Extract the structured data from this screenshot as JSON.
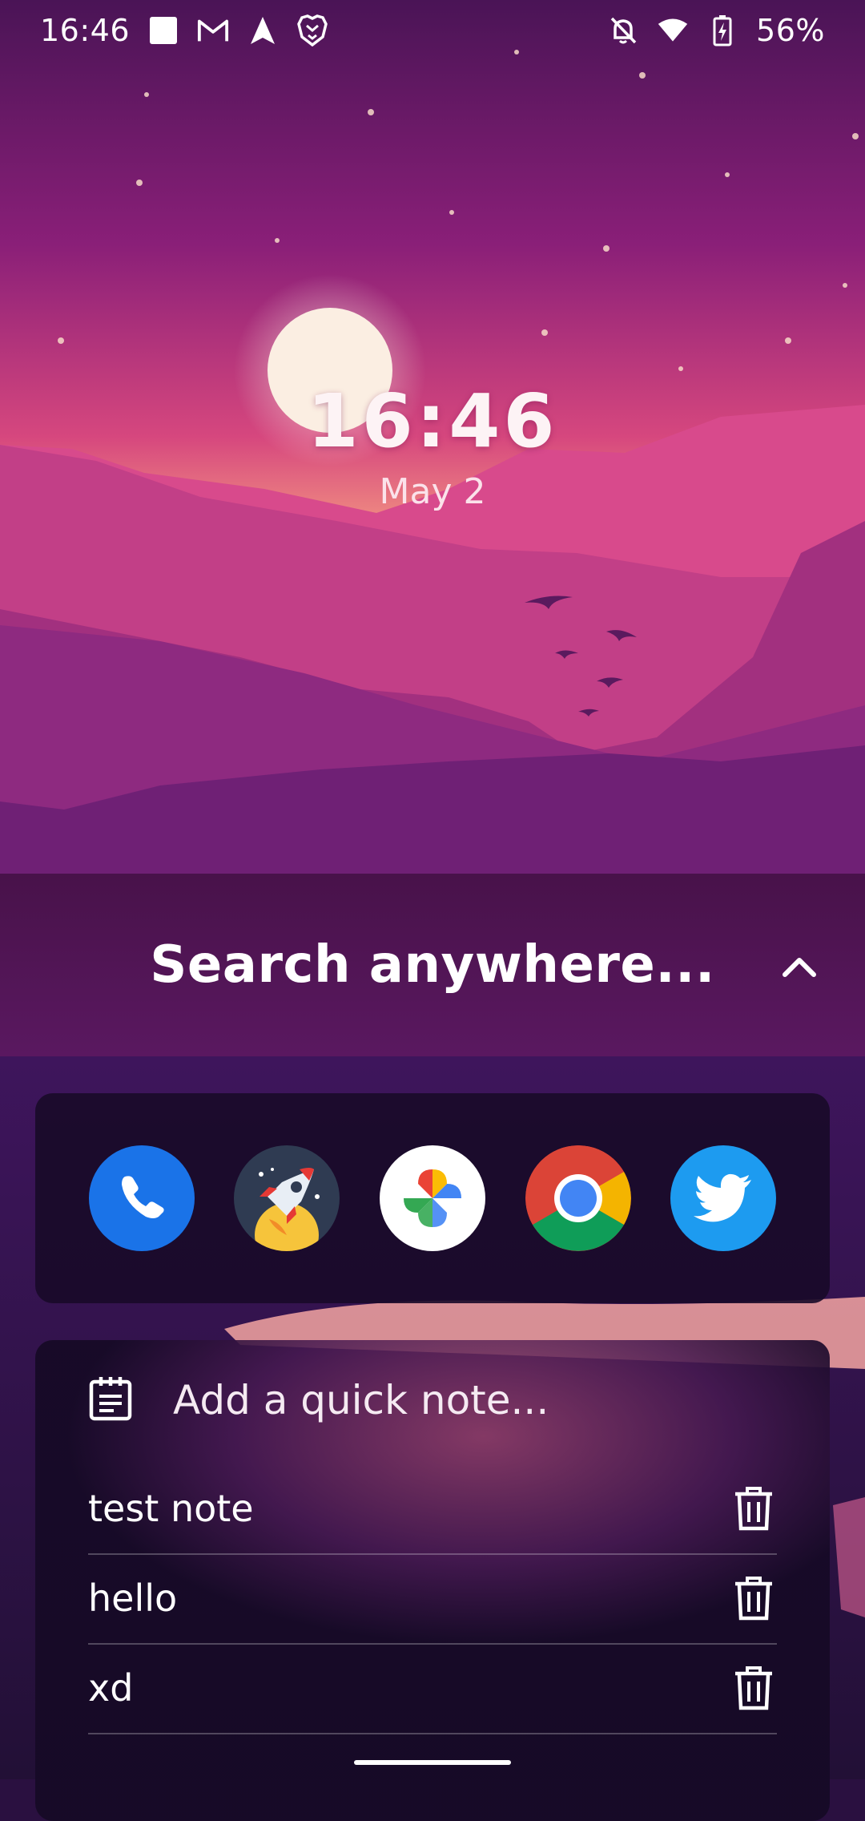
{
  "status_bar": {
    "time": "16:46",
    "battery_percent": "56%",
    "left_icons": [
      "square-notification-icon",
      "gmail-icon",
      "navigation-arrow-icon",
      "brave-lion-icon"
    ],
    "right_icons": [
      "bell-off-icon",
      "wifi-icon",
      "battery-charging-icon"
    ]
  },
  "clock": {
    "time": "16:46",
    "date": "May 2"
  },
  "search": {
    "placeholder": "Search anywhere..."
  },
  "apps": [
    {
      "name": "Phone",
      "icon": "phone-icon",
      "color": "#1a73e8"
    },
    {
      "name": "Launcher",
      "icon": "rocket-icon",
      "color": "#2f3b52"
    },
    {
      "name": "Photos",
      "icon": "pinwheel-icon",
      "color": "#ffffff"
    },
    {
      "name": "Chrome",
      "icon": "chrome-icon",
      "color": "#4285f4"
    },
    {
      "name": "Twitter",
      "icon": "twitter-bird-icon",
      "color": "#1d9bf0"
    }
  ],
  "notes": {
    "input_label": "Add a quick note...",
    "items": [
      {
        "text": "test note"
      },
      {
        "text": "hello"
      },
      {
        "text": "xd"
      }
    ]
  }
}
